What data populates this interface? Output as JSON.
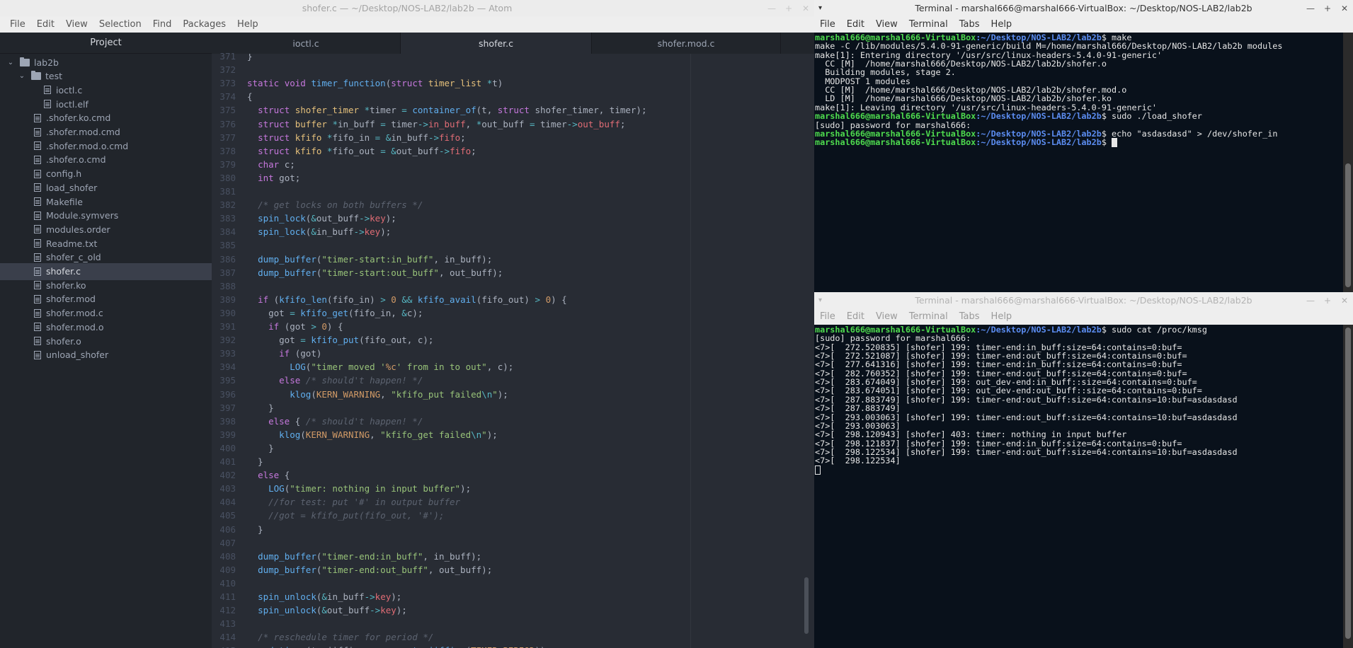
{
  "atom": {
    "title": "shofer.c — ~/Desktop/NOS-LAB2/lab2b — Atom",
    "menu": [
      "File",
      "Edit",
      "View",
      "Selection",
      "Find",
      "Packages",
      "Help"
    ],
    "project_header": "Project",
    "tree": [
      {
        "label": "lab2b",
        "kind": "folder",
        "chev": "⌄",
        "depth": 0
      },
      {
        "label": "test",
        "kind": "folder",
        "chev": "⌄",
        "depth": 1
      },
      {
        "label": "ioctl.c",
        "kind": "file",
        "depth": 2
      },
      {
        "label": "ioctl.elf",
        "kind": "file",
        "depth": 2
      },
      {
        "label": ".shofer.ko.cmd",
        "kind": "file",
        "depth": 1
      },
      {
        "label": ".shofer.mod.cmd",
        "kind": "file",
        "depth": 1
      },
      {
        "label": ".shofer.mod.o.cmd",
        "kind": "file",
        "depth": 1
      },
      {
        "label": ".shofer.o.cmd",
        "kind": "file",
        "depth": 1
      },
      {
        "label": "config.h",
        "kind": "file",
        "depth": 1
      },
      {
        "label": "load_shofer",
        "kind": "file",
        "depth": 1
      },
      {
        "label": "Makefile",
        "kind": "file",
        "depth": 1
      },
      {
        "label": "Module.symvers",
        "kind": "file",
        "depth": 1
      },
      {
        "label": "modules.order",
        "kind": "file",
        "depth": 1
      },
      {
        "label": "Readme.txt",
        "kind": "file",
        "depth": 1
      },
      {
        "label": "shofer_c_old",
        "kind": "file",
        "depth": 1
      },
      {
        "label": "shofer.c",
        "kind": "file",
        "depth": 1,
        "selected": true
      },
      {
        "label": "shofer.ko",
        "kind": "file",
        "depth": 1
      },
      {
        "label": "shofer.mod",
        "kind": "file",
        "depth": 1
      },
      {
        "label": "shofer.mod.c",
        "kind": "file",
        "depth": 1
      },
      {
        "label": "shofer.mod.o",
        "kind": "file",
        "depth": 1
      },
      {
        "label": "shofer.o",
        "kind": "file",
        "depth": 1
      },
      {
        "label": "unload_shofer",
        "kind": "file",
        "depth": 1
      }
    ],
    "tabs": [
      {
        "label": "ioctl.c"
      },
      {
        "label": "shofer.c",
        "active": true
      },
      {
        "label": "shofer.mod.c"
      }
    ],
    "code": [
      {
        "n": "371",
        "h": "}"
      },
      {
        "n": "372",
        "h": ""
      },
      {
        "n": "373",
        "h": "<span class='k'>static</span> <span class='k'>void</span> <span class='f'>timer_function</span>(<span class='k'>struct</span> <span class='t'>timer_list</span> <span class='o'>*</span>t)"
      },
      {
        "n": "374",
        "h": "{"
      },
      {
        "n": "375",
        "h": "  <span class='k'>struct</span> <span class='t'>shofer_timer</span> <span class='o'>*</span>timer <span class='o'>=</span> <span class='f'>container_of</span>(t, <span class='k'>struct</span> shofer_timer, timer);"
      },
      {
        "n": "376",
        "h": "  <span class='k'>struct</span> <span class='t'>buffer</span> <span class='o'>*</span>in_buff <span class='o'>=</span> timer<span class='o'>-&gt;</span><span class='r'>in_buff</span>, <span class='o'>*</span>out_buff <span class='o'>=</span> timer<span class='o'>-&gt;</span><span class='r'>out_buff</span>;"
      },
      {
        "n": "377",
        "h": "  <span class='k'>struct</span> <span class='t'>kfifo</span> <span class='o'>*</span>fifo_in <span class='o'>=</span> <span class='o'>&amp;</span>in_buff<span class='o'>-&gt;</span><span class='r'>fifo</span>;"
      },
      {
        "n": "378",
        "h": "  <span class='k'>struct</span> <span class='t'>kfifo</span> <span class='o'>*</span>fifo_out <span class='o'>=</span> <span class='o'>&amp;</span>out_buff<span class='o'>-&gt;</span><span class='r'>fifo</span>;"
      },
      {
        "n": "379",
        "h": "  <span class='k'>char</span> c;"
      },
      {
        "n": "380",
        "h": "  <span class='k'>int</span> got;"
      },
      {
        "n": "381",
        "h": ""
      },
      {
        "n": "382",
        "h": "  <span class='c'>/* get locks on both buffers */</span>"
      },
      {
        "n": "383",
        "h": "  <span class='f'>spin_lock</span>(<span class='o'>&amp;</span>out_buff<span class='o'>-&gt;</span><span class='r'>key</span>);"
      },
      {
        "n": "384",
        "h": "  <span class='f'>spin_lock</span>(<span class='o'>&amp;</span>in_buff<span class='o'>-&gt;</span><span class='r'>key</span>);"
      },
      {
        "n": "385",
        "h": ""
      },
      {
        "n": "386",
        "h": "  <span class='f'>dump_buffer</span>(<span class='s'>\"timer-start:in_buff\"</span>, in_buff);"
      },
      {
        "n": "387",
        "h": "  <span class='f'>dump_buffer</span>(<span class='s'>\"timer-start:out_buff\"</span>, out_buff);"
      },
      {
        "n": "388",
        "h": ""
      },
      {
        "n": "389",
        "h": "  <span class='k'>if</span> (<span class='f'>kfifo_len</span>(fifo_in) <span class='o'>&gt;</span> <span class='n'>0</span> <span class='o'>&amp;&amp;</span> <span class='f'>kfifo_avail</span>(fifo_out) <span class='o'>&gt;</span> <span class='n'>0</span>) {"
      },
      {
        "n": "390",
        "h": "    got <span class='o'>=</span> <span class='f'>kfifo_get</span>(fifo_in, <span class='o'>&amp;</span>c);"
      },
      {
        "n": "391",
        "h": "    <span class='k'>if</span> (got <span class='o'>&gt;</span> <span class='n'>0</span>) {"
      },
      {
        "n": "392",
        "h": "      got <span class='o'>=</span> <span class='f'>kfifo_put</span>(fifo_out, c);"
      },
      {
        "n": "393",
        "h": "      <span class='k'>if</span> (got)"
      },
      {
        "n": "394",
        "h": "        <span class='f'>LOG</span>(<span class='s'>\"timer moved '<span class='n'>%c</span>' from in to out\"</span>, c);"
      },
      {
        "n": "395",
        "h": "      <span class='k'>else</span> <span class='c'>/* should't happen! */</span>"
      },
      {
        "n": "396",
        "h": "        <span class='f'>klog</span>(<span class='n'>KERN_WARNING</span>, <span class='s'>\"kfifo_put failed<span class='o'>\\n</span>\"</span>);"
      },
      {
        "n": "397",
        "h": "    }"
      },
      {
        "n": "398",
        "h": "    <span class='k'>else</span> { <span class='c'>/* should't happen! */</span>"
      },
      {
        "n": "399",
        "h": "      <span class='f'>klog</span>(<span class='n'>KERN_WARNING</span>, <span class='s'>\"kfifo_get failed<span class='o'>\\n</span>\"</span>);"
      },
      {
        "n": "400",
        "h": "    }"
      },
      {
        "n": "401",
        "h": "  }"
      },
      {
        "n": "402",
        "h": "  <span class='k'>else</span> {"
      },
      {
        "n": "403",
        "h": "    <span class='f'>LOG</span>(<span class='s'>\"timer: nothing in input buffer\"</span>);"
      },
      {
        "n": "404",
        "h": "    <span class='c'>//for test: put '#' in output buffer</span>"
      },
      {
        "n": "405",
        "h": "    <span class='c'>//got = kfifo_put(fifo_out, '#');</span>"
      },
      {
        "n": "406",
        "h": "  }"
      },
      {
        "n": "407",
        "h": ""
      },
      {
        "n": "408",
        "h": "  <span class='f'>dump_buffer</span>(<span class='s'>\"timer-end:in_buff\"</span>, in_buff);"
      },
      {
        "n": "409",
        "h": "  <span class='f'>dump_buffer</span>(<span class='s'>\"timer-end:out_buff\"</span>, out_buff);"
      },
      {
        "n": "410",
        "h": ""
      },
      {
        "n": "411",
        "h": "  <span class='f'>spin_unlock</span>(<span class='o'>&amp;</span>in_buff<span class='o'>-&gt;</span><span class='r'>key</span>);"
      },
      {
        "n": "412",
        "h": "  <span class='f'>spin_unlock</span>(<span class='o'>&amp;</span>out_buff<span class='o'>-&gt;</span><span class='r'>key</span>);"
      },
      {
        "n": "413",
        "h": ""
      },
      {
        "n": "414",
        "h": "  <span class='c'>/* reschedule timer for period */</span>"
      },
      {
        "n": "415",
        "h": "  <span class='f'>mod_timer</span>(t, jiffies <span class='o'>+</span> <span class='f'>msecs_to_jiffies</span>(<span class='n'>TIMER_PERIOD</span>));"
      }
    ]
  },
  "term1": {
    "title": "Terminal - marshal666@marshal666-VirtualBox: ~/Desktop/NOS-LAB2/lab2b",
    "menu": [
      "File",
      "Edit",
      "View",
      "Terminal",
      "Tabs",
      "Help"
    ],
    "lines": [
      {
        "p": true,
        "user": "marshal666@marshal666-VirtualBox",
        "path": ":~/Desktop/NOS-LAB2/lab2b",
        "cmd": "$ make"
      },
      {
        "text": "make -C /lib/modules/5.4.0-91-generic/build M=/home/marshal666/Desktop/NOS-LAB2/lab2b modules"
      },
      {
        "text": "make[1]: Entering directory '/usr/src/linux-headers-5.4.0-91-generic'"
      },
      {
        "text": "  CC [M]  /home/marshal666/Desktop/NOS-LAB2/lab2b/shofer.o"
      },
      {
        "text": "  Building modules, stage 2."
      },
      {
        "text": "  MODPOST 1 modules"
      },
      {
        "text": "  CC [M]  /home/marshal666/Desktop/NOS-LAB2/lab2b/shofer.mod.o"
      },
      {
        "text": "  LD [M]  /home/marshal666/Desktop/NOS-LAB2/lab2b/shofer.ko"
      },
      {
        "text": "make[1]: Leaving directory '/usr/src/linux-headers-5.4.0-91-generic'"
      },
      {
        "p": true,
        "user": "marshal666@marshal666-VirtualBox",
        "path": ":~/Desktop/NOS-LAB2/lab2b",
        "cmd": "$ sudo ./load_shofer"
      },
      {
        "text": "[sudo] password for marshal666:"
      },
      {
        "p": true,
        "user": "marshal666@marshal666-VirtualBox",
        "path": ":~/Desktop/NOS-LAB2/lab2b",
        "cmd": "$ echo \"asdasdasd\" > /dev/shofer_in"
      },
      {
        "p": true,
        "user": "marshal666@marshal666-VirtualBox",
        "path": ":~/Desktop/NOS-LAB2/lab2b",
        "cmd": "$ ",
        "cursor": true
      }
    ]
  },
  "term2": {
    "title": "Terminal - marshal666@marshal666-VirtualBox: ~/Desktop/NOS-LAB2/lab2b",
    "menu": [
      "File",
      "Edit",
      "View",
      "Terminal",
      "Tabs",
      "Help"
    ],
    "lines": [
      {
        "p": true,
        "user": "marshal666@marshal666-VirtualBox",
        "path": ":~/Desktop/NOS-LAB2/lab2b",
        "cmd": "$ sudo cat /proc/kmsg"
      },
      {
        "text": "[sudo] password for marshal666:"
      },
      {
        "text": "<7>[  272.520835] [shofer] 199: timer-end:in_buff:size=64:contains=0:buf="
      },
      {
        "text": "<7>[  272.521087] [shofer] 199: timer-end:out_buff:size=64:contains=0:buf="
      },
      {
        "text": "<7>[  277.641316] [shofer] 199: timer-end:in_buff:size=64:contains=0:buf="
      },
      {
        "text": "<7>[  282.760352] [shofer] 199: timer-end:out_buff:size=64:contains=0:buf="
      },
      {
        "text": "<7>[  283.674049] [shofer] 199: out_dev-end:in_buff::size=64:contains=0:buf="
      },
      {
        "text": "<7>[  283.674051] [shofer] 199: out_dev-end:out_buff::size=64:contains=0:buf="
      },
      {
        "text": "<7>[  287.883749] [shofer] 199: timer-end:out_buff:size=64:contains=10:buf=asdasdasd"
      },
      {
        "text": "<7>[  287.883749]"
      },
      {
        "text": "<7>[  293.003063] [shofer] 199: timer-end:out_buff:size=64:contains=10:buf=asdasdasd"
      },
      {
        "text": "<7>[  293.003063]"
      },
      {
        "text": "<7>[  298.120943] [shofer] 403: timer: nothing in input buffer"
      },
      {
        "text": "<7>[  298.121837] [shofer] 199: timer-end:in_buff:size=64:contains=0:buf="
      },
      {
        "text": "<7>[  298.122534] [shofer] 199: timer-end:out_buff:size=64:contains=10:buf=asdasdasd"
      },
      {
        "text": "<7>[  298.122534]"
      },
      {
        "cursor": "hollow"
      }
    ]
  },
  "wctrl": {
    "min": "—",
    "max": "+",
    "close": "✕",
    "menu_arrow": "▾"
  }
}
